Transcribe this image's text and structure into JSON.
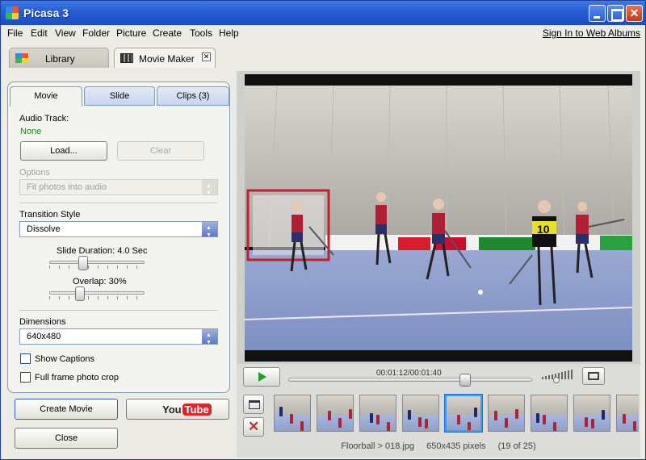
{
  "window": {
    "title": "Picasa 3"
  },
  "menu": {
    "items": [
      "File",
      "Edit",
      "View",
      "Folder",
      "Picture",
      "Create",
      "Tools",
      "Help"
    ],
    "sign_in": "Sign In to Web Albums"
  },
  "app_tabs": {
    "library": "Library",
    "movie_maker": "Movie Maker"
  },
  "left_panel": {
    "tabs": [
      "Movie",
      "Slide",
      "Clips (3)"
    ],
    "audio_track_label": "Audio Track:",
    "audio_track_value": "None",
    "load_button": "Load...",
    "clear_button": "Clear",
    "options_label": "Options",
    "options_value": "Fit photos into audio",
    "transition_label": "Transition Style",
    "transition_value": "Dissolve",
    "slide_duration_label": "Slide Duration: 4.0 Sec",
    "slide_duration_level": 0.34,
    "overlap_label": "Overlap: 30%",
    "overlap_level": 0.3,
    "dimensions_label": "Dimensions",
    "dimensions_value": "640x480",
    "show_captions": "Show Captions",
    "full_frame": "Full frame photo crop"
  },
  "buttons": {
    "create_movie": "Create Movie",
    "youtube_you": "You",
    "youtube_tube": "Tube",
    "close": "Close"
  },
  "player": {
    "timecode": "00:01:12/00:01:40",
    "progress": 0.72
  },
  "status": {
    "path": "Floorball > 018.jpg",
    "size": "650x435 pixels",
    "position": "(19 of 25)"
  },
  "filmstrip": {
    "count": 9,
    "selected_index": 4
  }
}
